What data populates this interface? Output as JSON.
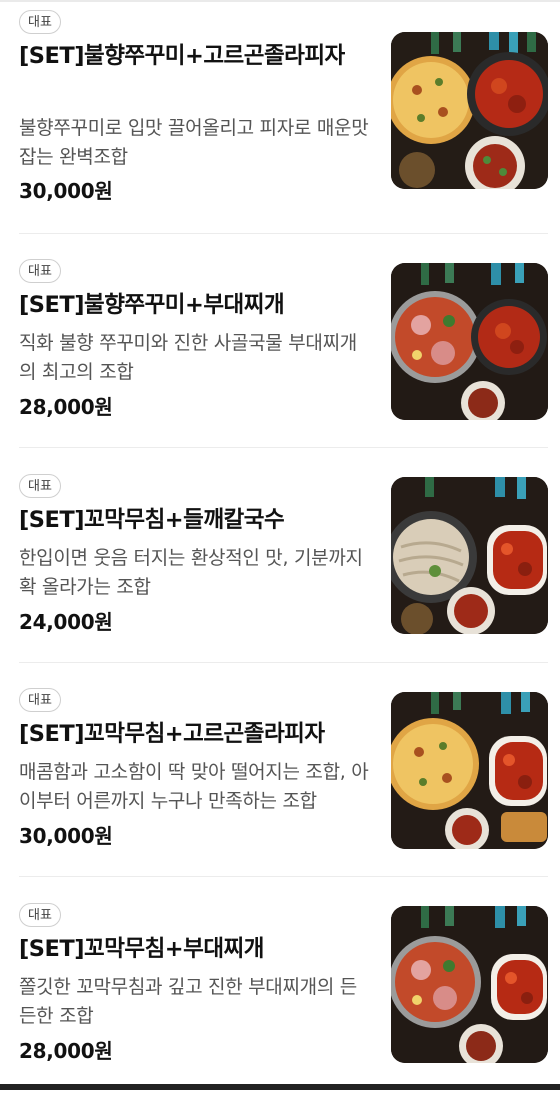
{
  "menu": {
    "items": [
      {
        "badge": "대표",
        "title": "[SET]불향쭈꾸미+고르곤졸라피자",
        "description": "불향쭈꾸미로 입맛 끌어올리고 피자로 매운맛 잡는 완벽조합",
        "price": "30,000원",
        "image": "jjukkumi-pizza-photo"
      },
      {
        "badge": "대표",
        "title": "[SET]불향쭈꾸미+부대찌개",
        "description": "직화 불향 쭈꾸미와 진한 사골국물 부대찌개의 최고의 조합",
        "price": "28,000원",
        "image": "jjukkumi-stew-photo"
      },
      {
        "badge": "대표",
        "title": "[SET]꼬막무침+들깨칼국수",
        "description": "한입이면 웃음 터지는 환상적인 맛, 기분까지 확 올라가는 조합",
        "price": "24,000원",
        "image": "cockle-noodle-photo"
      },
      {
        "badge": "대표",
        "title": "[SET]꼬막무침+고르곤졸라피자",
        "description": "매콤함과 고소함이 딱 맞아 떨어지는 조합, 아이부터 어른까지 누구나 만족하는 조합",
        "price": "30,000원",
        "image": "cockle-pizza-photo"
      },
      {
        "badge": "대표",
        "title": "[SET]꼬막무침+부대찌개",
        "description": "쫄깃한 꼬막무침과 깊고 진한 부대찌개의 든든한 조합",
        "price": "28,000원",
        "image": "cockle-stew-photo"
      }
    ]
  },
  "colors": {
    "background": "#ffffff",
    "title": "#111111",
    "description": "#555555",
    "badge_border": "#cfcfcf",
    "divider": "#ececec"
  }
}
